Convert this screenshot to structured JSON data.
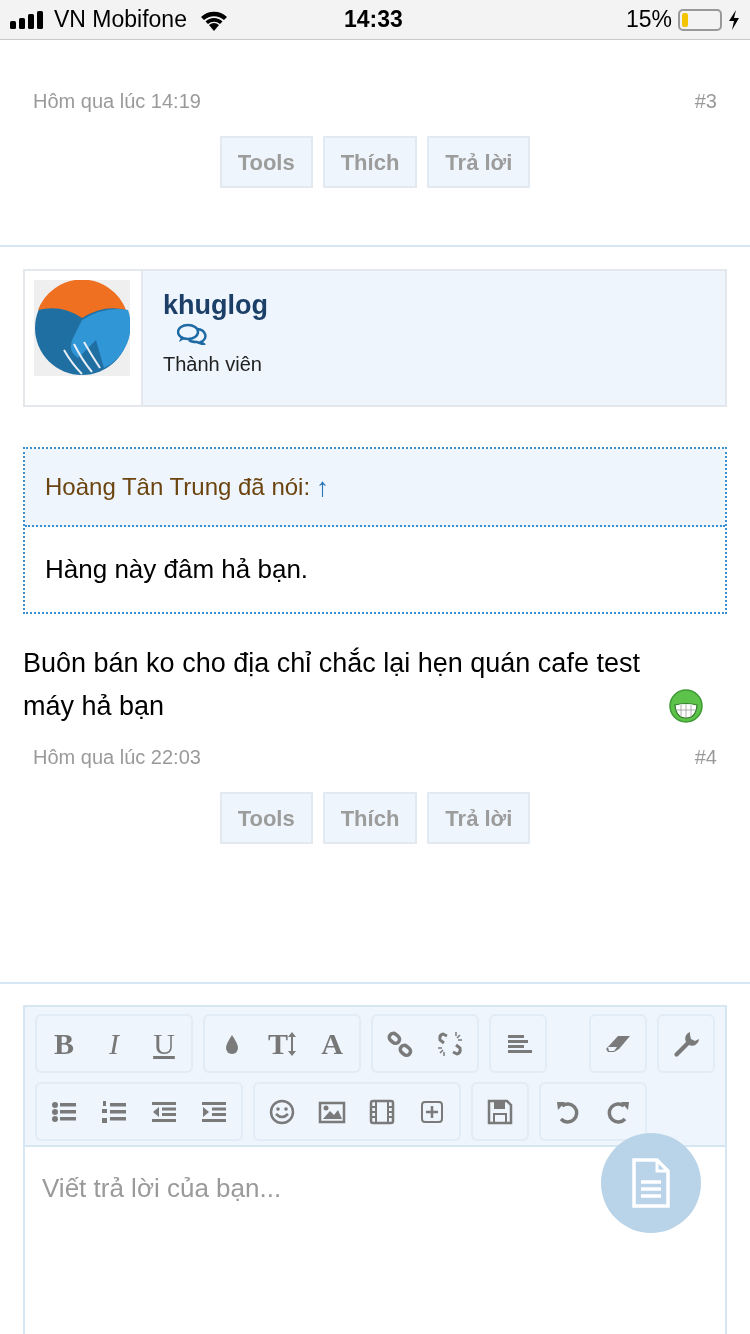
{
  "status_bar": {
    "carrier": "VN Mobifone",
    "time": "14:33",
    "battery_percent": "15%"
  },
  "posts": [
    {
      "kind": "tail",
      "date": "Hôm qua lúc 14:19",
      "number": "#3",
      "actions": [
        "Tools",
        "Thích",
        "Trả lời"
      ]
    },
    {
      "kind": "full",
      "user": {
        "name": "khuglog",
        "role": "Thành viên"
      },
      "quote": {
        "author": "Hoàng Tân Trung đã nói:",
        "arrow": "↑",
        "text": "Hàng này đâm hả bạn."
      },
      "text": "Buôn bán ko cho địa chỉ chắc lại hẹn quán cafe test máy hả bạn",
      "date": "Hôm qua lúc 22:03",
      "number": "#4",
      "actions": [
        "Tools",
        "Thích",
        "Trả lời"
      ]
    }
  ],
  "editor": {
    "toolbar_glyphs": [
      "B",
      "I",
      "U",
      "T",
      "A"
    ],
    "placeholder": "Viết trả lời của bạn..."
  }
}
